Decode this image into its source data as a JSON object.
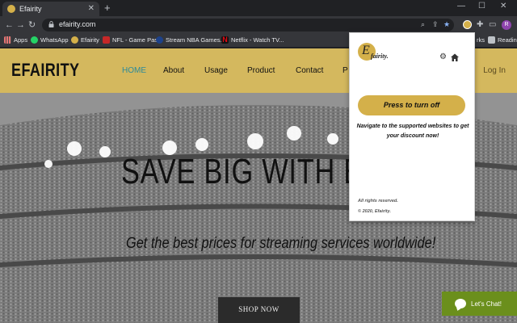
{
  "browser": {
    "tab": {
      "title": "Efairity",
      "favicon": "efairity-favicon"
    },
    "new_tab": "+",
    "url": "efairity.com",
    "profile_initial": "R",
    "bookmarks": [
      {
        "label": "Apps",
        "icon": "apps-grid-icon",
        "color": "#e8eaed"
      },
      {
        "label": "WhatsApp",
        "icon": "whatsapp-icon",
        "color": "#25d366"
      },
      {
        "label": "Efairity",
        "icon": "efairity-icon",
        "color": "#d4b04a"
      },
      {
        "label": "NFL - Game Pass",
        "icon": "nfl-icon",
        "color": "#c62828"
      },
      {
        "label": "Stream NBA Games...",
        "icon": "nba-icon",
        "color": "#1d428a"
      },
      {
        "label": "Netflix - Watch TV...",
        "icon": "netflix-icon",
        "color": "#e50914"
      },
      {
        "label": "rks",
        "icon": "folder-icon",
        "color": "#bdc1c6"
      },
      {
        "label": "Reading",
        "icon": "reading-list-icon",
        "color": "#bdc1c6"
      }
    ]
  },
  "site": {
    "logo": "EFAIRITY",
    "nav": [
      "HOME",
      "About",
      "Usage",
      "Product",
      "Contact",
      "P"
    ],
    "login": "Log In",
    "headline": "SAVE BIG WITH EFAI",
    "tagline": "Get the best prices for streaming services worldwide!",
    "shop_button": "SHOP NOW",
    "chat_button": "Let's Chat!",
    "colors": {
      "accent": "#d4b85e",
      "nav_active": "#2b8a9a",
      "chat": "#6b8f1c"
    }
  },
  "popup": {
    "brand_letter": "E",
    "brand_name": "fairity.",
    "toggle_button": "Press to turn off",
    "message": "Navigate to the supported websites to get your discount now!",
    "rights": "All rights reserved.",
    "copyright": "© 2020, Efairity."
  }
}
